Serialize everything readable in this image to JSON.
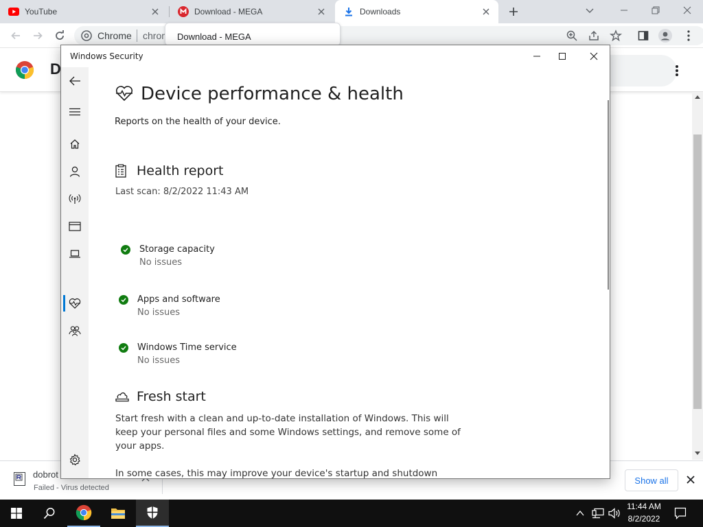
{
  "browser": {
    "tabs": [
      {
        "title": "YouTube",
        "icon": "youtube-icon"
      },
      {
        "title": "Download - MEGA",
        "icon": "mega-icon"
      },
      {
        "title": "Downloads",
        "icon": "download-arrow-icon"
      }
    ],
    "omnibox": {
      "site": "Chrome",
      "url_fragment": "chrom"
    },
    "tooltip": "Download - MEGA",
    "page_title_initial": "D"
  },
  "download_shelf": {
    "file_name": "dobrot",
    "status": "Failed - Virus detected",
    "show_all_label": "Show all"
  },
  "window": {
    "title": "Windows Security",
    "page_title": "Device performance & health",
    "page_subtitle": "Reports on the health of your device.",
    "health_report": {
      "heading": "Health report",
      "last_scan": "Last scan: 8/2/2022 11:43 AM",
      "items": [
        {
          "title": "Storage capacity",
          "status": "No issues"
        },
        {
          "title": "Apps and software",
          "status": "No issues"
        },
        {
          "title": "Windows Time service",
          "status": "No issues"
        }
      ]
    },
    "fresh_start": {
      "heading": "Fresh start",
      "body": "Start fresh with a clean and up-to-date installation of Windows. This will keep your personal files and some Windows settings, and remove some of your apps.",
      "body2": "In some cases, this may improve your device's startup and shutdown"
    }
  },
  "taskbar": {
    "time": "11:44 AM",
    "date": "8/2/2022"
  },
  "colors": {
    "accent": "#0078d4",
    "status_ok": "#107c10",
    "taskbar": "#101010",
    "youtube": "#ff0000",
    "mega": "#d9272e"
  }
}
